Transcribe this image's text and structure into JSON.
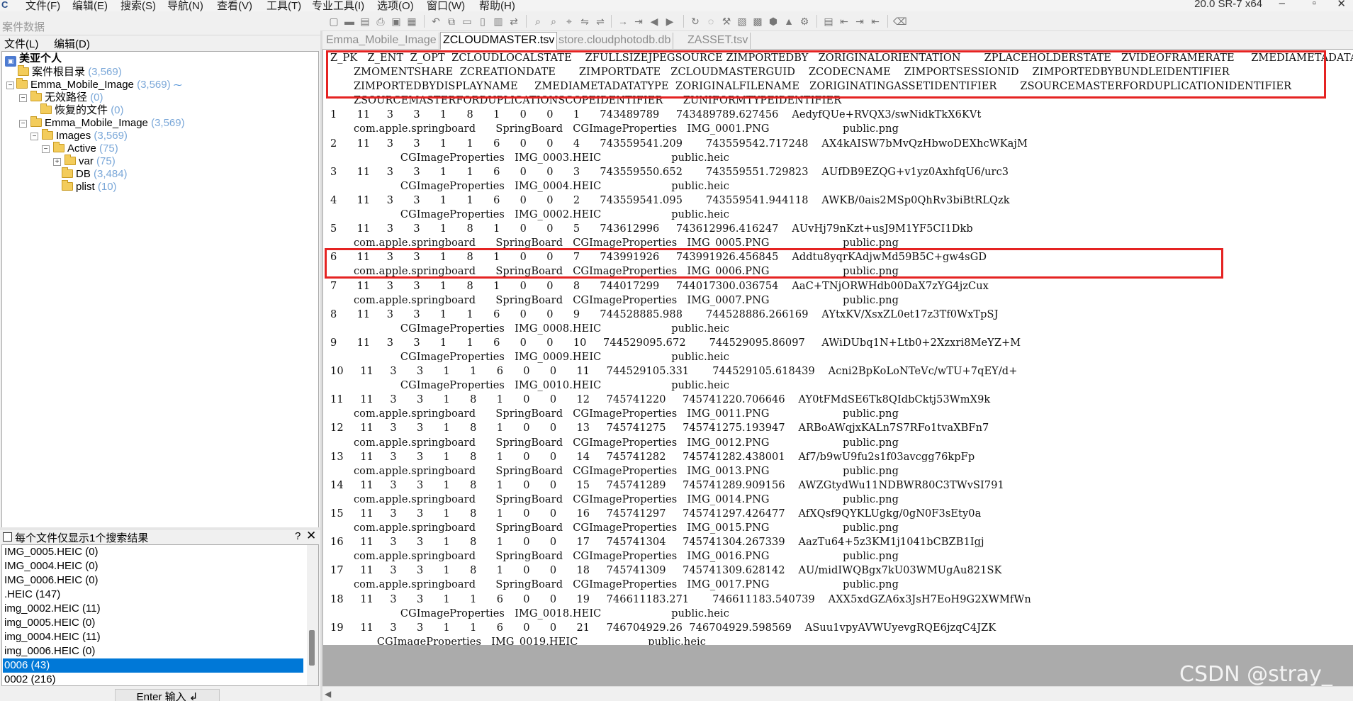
{
  "app": {
    "menus": [
      "文件(F)",
      "编辑(E)",
      "搜索(S)",
      "导航(N)",
      "查看(V)",
      "工具(T)",
      "专业工具(I)",
      "选项(O)",
      "窗口(W)",
      "帮助(H)"
    ],
    "version": "20.0 SR-7 x64"
  },
  "left_pane": {
    "title": "案件数据",
    "menu": [
      "文件(L)",
      "编辑(D)"
    ],
    "tree": [
      {
        "label": "美亚个人",
        "count": ""
      },
      {
        "label": "案件根目录",
        "count": "(3,569)"
      },
      {
        "label": "Emma_Mobile_Image",
        "count": "(3,569)"
      },
      {
        "label": "无效路径",
        "count": "(0)"
      },
      {
        "label": "恢复的文件",
        "count": "(0)"
      },
      {
        "label": "Emma_Mobile_Image",
        "count": "(3,569)"
      },
      {
        "label": "Images",
        "count": "(3,569)"
      },
      {
        "label": "Active",
        "count": "(75)"
      },
      {
        "label": "var",
        "count": "(75)"
      },
      {
        "label": "DB",
        "count": "(3,484)"
      },
      {
        "label": "plist",
        "count": "(10)"
      }
    ],
    "search_option": "每个文件仅显示1个搜索结果",
    "results": [
      "IMG_0005.HEIC (0)",
      "IMG_0004.HEIC (0)",
      "IMG_0006.HEIC (0)",
      ".HEIC (147)",
      "img_0002.HEIC (11)",
      "img_0005.HEIC (0)",
      "img_0004.HEIC (11)",
      "img_0006.HEIC (0)",
      "0006 (43)",
      "0002 (216)"
    ],
    "selected_result": "0006 (43)",
    "enter_button": "Enter 输入 ↲"
  },
  "tabs": [
    "Emma_Mobile_Image",
    "ZCLOUDMASTER.tsv",
    "store.cloudphotodb.db",
    "ZASSET.tsv"
  ],
  "active_tab": "ZCLOUDMASTER.tsv",
  "tsv_lines": [
    "Z_PK   Z_ENT  Z_OPT  ZCLOUDLOCALSTATE    ZFULLSIZEJPEGSOURCE ZIMPORTEDBY   ZORIGINALORIENTATION       ZPLACEHOLDERSTATE   ZVIDEOFRAMERATE     ZMEDIAMETADATA",
    "       ZMOMENTSHARE  ZCREATIONDATE       ZIMPORTDATE   ZCLOUDMASTERGUID    ZCODECNAME    ZIMPORTSESSIONID    ZIMPORTEDBYBUNDLEIDENTIFIER",
    "       ZIMPORTEDBYDISPLAYNAME     ZMEDIAMETADATATYPE  ZORIGINALFILENAME   ZORIGINATINGASSETIDENTIFIER       ZSOURCEMASTERFORDUPLICATIONIDENTIFIER",
    "       ZSOURCEMASTERFORDUPLICATIONSCOPEIDENTIFIER      ZUNIFORMTYPEIDENTIFIER",
    "1      11     3      3      1      8      1      0      0      1      743489789     743489789.627456    AedyfQUe+RVQX3/swNidkTkX6KVt",
    "       com.apple.springboard      SpringBoard   CGImageProperties   IMG_0001.PNG                      public.png",
    "2      11     3      3      1      1      6      0      0      4      743559541.209       743559542.717248    AX4kAISW7bMvQzHbwoDEXhcWKajM",
    "                     CGImageProperties   IMG_0003.HEIC                     public.heic",
    "3      11     3      3      1      1      6      0      0      3      743559550.652       743559551.729823    AUfDB9EZQG+v1yz0AxhfqU6/urc3",
    "                     CGImageProperties   IMG_0004.HEIC                     public.heic",
    "4      11     3      3      1      1      6      0      0      2      743559541.095       743559541.944118    AWKB/0ais2MSp0QhRv3biBtRLQzk",
    "                     CGImageProperties   IMG_0002.HEIC                     public.heic",
    "5      11     3      3      1      8      1      0      0      5      743612996     743612996.416247    AUvHj79nKzt+usJ9M1YF5CI1Dkb",
    "       com.apple.springboard      SpringBoard   CGImageProperties   IMG_0005.PNG                      public.png",
    "6      11     3      3      1      8      1      0      0      7      743991926     743991926.456845    Addtu8yqrKAdjwMd59B5C+gw4sGD",
    "       com.apple.springboard      SpringBoard   CGImageProperties   IMG_0006.PNG                      public.png",
    "7      11     3      3      1      8      1      0      0      8      744017299     744017300.036754    AaC+TNjORWHdb00DaX7zYG4jzCux",
    "       com.apple.springboard      SpringBoard   CGImageProperties   IMG_0007.PNG                      public.png",
    "8      11     3      3      1      1      6      0      0      9      744528885.988       744528886.266169    AYtxKV/XsxZL0et17z3Tf0WxTpSJ",
    "                     CGImageProperties   IMG_0008.HEIC                     public.heic",
    "9      11     3      3      1      1      6      0      0      10     744529095.672       744529095.86097     AWiDUbq1N+Ltb0+2Xzxri8MeYZ+M",
    "                     CGImageProperties   IMG_0009.HEIC                     public.heic",
    "10     11     3      3      1      1      6      0      0      11     744529105.331       744529105.618439    Acni2BpKoLoNTeVc/wTU+7qEY/d+",
    "                     CGImageProperties   IMG_0010.HEIC                     public.heic",
    "11     11     3      3      1      8      1      0      0      12     745741220     745741220.706646    AY0tFMdSE6Tk8QIdbCktj53WmX9k",
    "       com.apple.springboard      SpringBoard   CGImageProperties   IMG_0011.PNG                      public.png",
    "12     11     3      3      1      8      1      0      0      13     745741275     745741275.193947    ARBoAWqjxKALn7S7RFo1tvaXBFn7",
    "       com.apple.springboard      SpringBoard   CGImageProperties   IMG_0012.PNG                      public.png",
    "13     11     3      3      1      8      1      0      0      14     745741282     745741282.438001    Af7/b9wU9fu2s1f03avcgg76kpFp",
    "       com.apple.springboard      SpringBoard   CGImageProperties   IMG_0013.PNG                      public.png",
    "14     11     3      3      1      8      1      0      0      15     745741289     745741289.909156    AWZGtydWu11NDBWR80C3TWvSI791",
    "       com.apple.springboard      SpringBoard   CGImageProperties   IMG_0014.PNG                      public.png",
    "15     11     3      3      1      8      1      0      0      16     745741297     745741297.426477    AfXQsf9QYKLUgkg/0gN0F3sEty0a",
    "       com.apple.springboard      SpringBoard   CGImageProperties   IMG_0015.PNG                      public.png",
    "16     11     3      3      1      8      1      0      0      17     745741304     745741304.267339    AazTu64+5z3KM1j1041bCBZB1Igj",
    "       com.apple.springboard      SpringBoard   CGImageProperties   IMG_0016.PNG                      public.png",
    "17     11     3      3      1      8      1      0      0      18     745741309     745741309.628142    AU/midIWQBgx7kU03WMUgAu821SK",
    "       com.apple.springboard      SpringBoard   CGImageProperties   IMG_0017.PNG                      public.png",
    "18     11     3      3      1      1      6      0      0      19     746611183.271       746611183.540739    AXX5xdGZA6x3JsH7EoH9G2XWMfWn",
    "                     CGImageProperties   IMG_0018.HEIC                     public.heic",
    "19     11     3      3      1      1      6      0      0      21     746704929.26  746704929.598569    ASuu1vpyAVWUyevgRQE6jzqC4JZK",
    "              CGImageProperties   IMG_0019.HEIC                     public.heic"
  ],
  "highlight_color": "#e52322",
  "watermark": "CSDN @stray_"
}
